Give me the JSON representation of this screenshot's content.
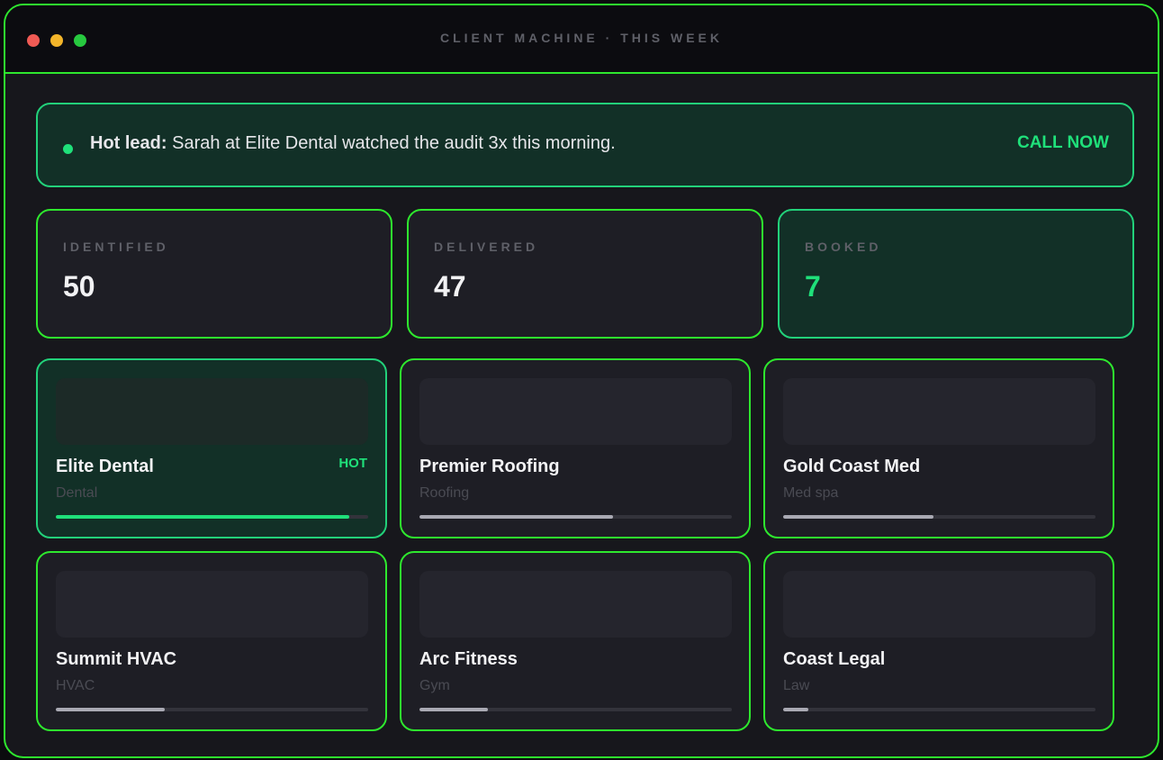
{
  "window": {
    "title": "CLIENT MACHINE · THIS WEEK"
  },
  "alert": {
    "lead_label": "Hot lead:",
    "message": " Sarah at Elite Dental watched the audit 3x this morning.",
    "action_label": "CALL NOW"
  },
  "stats": [
    {
      "label": "IDENTIFIED",
      "value": "50"
    },
    {
      "label": "DELIVERED",
      "value": "47"
    },
    {
      "label": "BOOKED",
      "value": "7"
    }
  ],
  "leads": [
    {
      "name": "Elite Dental",
      "category": "Dental",
      "tag": "HOT",
      "progress": 0.94
    },
    {
      "name": "Premier Roofing",
      "category": "Roofing",
      "tag": "",
      "progress": 0.62
    },
    {
      "name": "Gold Coast Med",
      "category": "Med spa",
      "tag": "",
      "progress": 0.48
    },
    {
      "name": "Summit HVAC",
      "category": "HVAC",
      "tag": "",
      "progress": 0.35
    },
    {
      "name": "Arc Fitness",
      "category": "Gym",
      "tag": "",
      "progress": 0.22
    },
    {
      "name": "Coast Legal",
      "category": "Law",
      "tag": "",
      "progress": 0.08
    }
  ],
  "colors": {
    "accent_green": "#1fe07a",
    "border_green": "#2ee82e",
    "window_bg": "#17171c",
    "card_bg": "#1e1e25",
    "hot_bg": "#123027",
    "progress_neutral": "#a9a9b3"
  }
}
